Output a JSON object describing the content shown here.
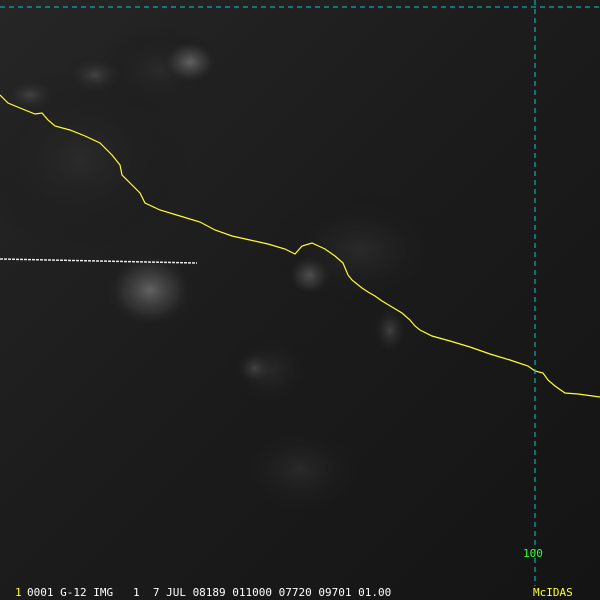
{
  "imagery": {
    "description_icon": "satellite-ir-imagery",
    "coastline_color": "#ffff33",
    "graticule_color": "#00cccc",
    "label_green": "#33ff33",
    "label_yellow": "#ffff33",
    "text_white": "#ffffff"
  },
  "grid": {
    "longitude_label": "100"
  },
  "status_bar": {
    "frame_number": "1",
    "text": "0001 G-12 IMG   1  7 JUL 08189 011000 07720 09701 01.00",
    "brand": "McIDAS"
  }
}
